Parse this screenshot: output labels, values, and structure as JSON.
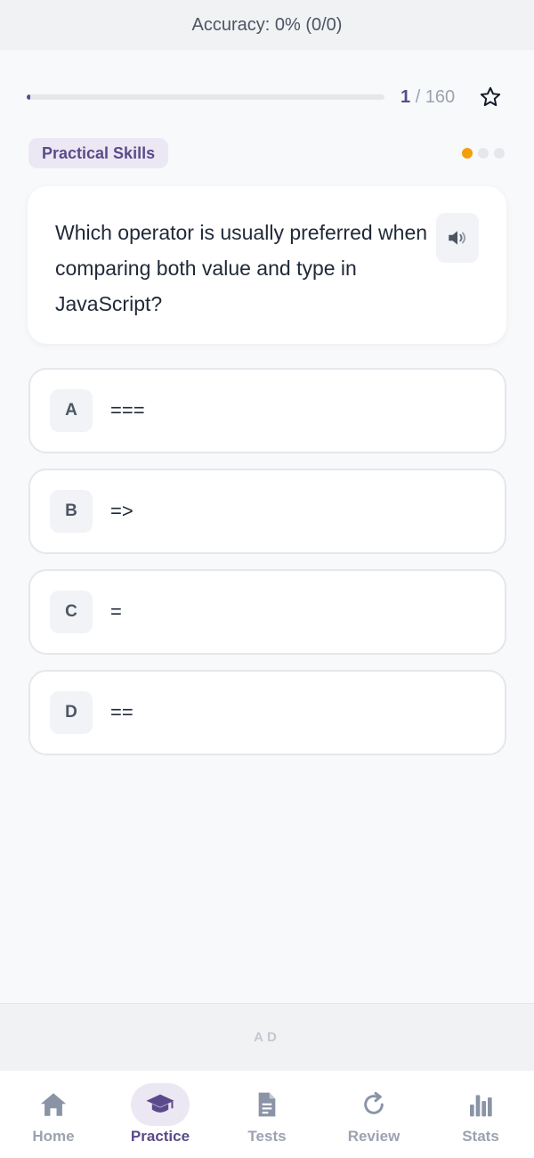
{
  "header": {
    "accuracy_text": "Accuracy: 0% (0/0)"
  },
  "progress": {
    "current": "1",
    "total": "/ 160",
    "fraction": 0.00625,
    "bookmark_icon": "star-outline-icon"
  },
  "question": {
    "category": "Practical Skills",
    "text": "Which operator is usually preferred when comparing both value and type in JavaScript?",
    "speaker_icon": "speaker-icon",
    "difficulty_dots": {
      "filled": 1,
      "total": 3,
      "filled_color": "#f59e0b"
    }
  },
  "options": [
    {
      "letter": "A",
      "text": "==="
    },
    {
      "letter": "B",
      "text": "=>"
    },
    {
      "letter": "C",
      "text": "="
    },
    {
      "letter": "D",
      "text": "=="
    }
  ],
  "ad": {
    "label": "AD"
  },
  "nav": {
    "active": "Practice",
    "items": [
      {
        "label": "Home",
        "icon": "home-icon"
      },
      {
        "label": "Practice",
        "icon": "graduation-cap-icon"
      },
      {
        "label": "Tests",
        "icon": "document-icon"
      },
      {
        "label": "Review",
        "icon": "refresh-icon"
      },
      {
        "label": "Stats",
        "icon": "bar-chart-icon"
      }
    ]
  },
  "colors": {
    "accent": "#5b4a8b",
    "muted": "#9ca3af",
    "icon_muted": "#8a94a6"
  }
}
